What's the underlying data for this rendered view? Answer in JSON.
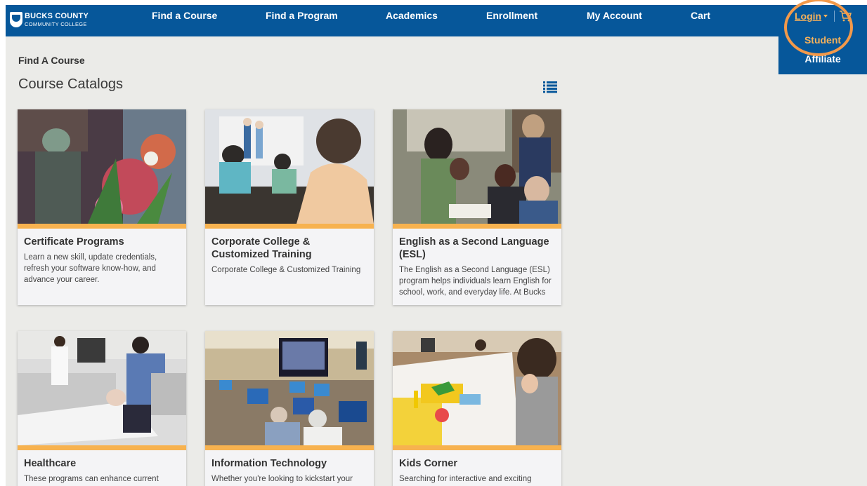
{
  "header": {
    "logo": {
      "line1": "BUCKS COUNTY",
      "line2": "COMMUNITY COLLEGE"
    },
    "nav": [
      {
        "label": "Find a Course"
      },
      {
        "label": "Find a Program"
      },
      {
        "label": "Academics"
      },
      {
        "label": "Enrollment"
      },
      {
        "label": "My Account"
      },
      {
        "label": "Cart"
      }
    ],
    "login": {
      "label": "Login"
    },
    "login_menu": [
      {
        "label": "Student"
      },
      {
        "label": "Affiliate"
      }
    ]
  },
  "colors": {
    "brand_blue": "#06579a",
    "accent_orange": "#f7b24f",
    "highlight": "#f2994a"
  },
  "content": {
    "breadcrumb": "Find A Course",
    "title": "Course Catalogs",
    "cards": [
      {
        "title": "Certificate Programs",
        "desc": "Learn a new skill, update credentials, refresh your software know-how, and advance your career."
      },
      {
        "title": "Corporate College & Customized Training",
        "desc": "Corporate College & Customized Training"
      },
      {
        "title": "English as a Second Language (ESL)",
        "desc": "The English as a Second Language (ESL) program helps individuals learn English for school, work, and everyday life. At Bucks"
      },
      {
        "title": "Healthcare",
        "desc": "These programs can enhance current"
      },
      {
        "title": "Information Technology",
        "desc": "Whether you're looking to kickstart your"
      },
      {
        "title": "Kids Corner",
        "desc": "Searching for interactive and exciting"
      }
    ]
  }
}
